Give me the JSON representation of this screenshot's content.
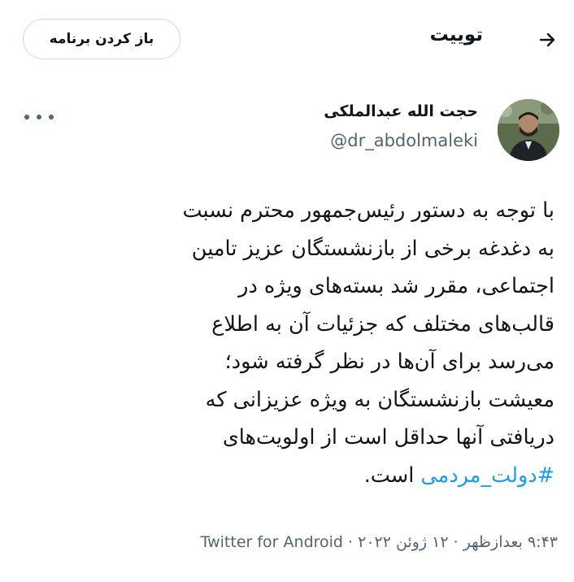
{
  "header": {
    "title": "توییت",
    "open_app_label": "باز کردن برنامه"
  },
  "icons": {
    "back": "back-arrow-icon",
    "more": "more-options-icon"
  },
  "author": {
    "name": "حجت الله عبدالملکی",
    "handle": "@dr_abdolmaleki"
  },
  "tweet": {
    "lines": [
      "با توجه به دستور رئیس‌جمهور محترم نسبت",
      "به دغدغه برخی از بازنشستگان عزیز تامین",
      "اجتماعی، مقرر شد بسته‌های ویژه در",
      "قالب‌های مختلف که جزئیات آن به اطلاع",
      "می‌رسد برای آن‌ها در نظر گرفته شود؛",
      "معیشت بازنشستگان به ویژه عزیزانی که",
      "دریافتی آنها حداقل است از اولویت‌های"
    ],
    "hashtag": "#دولت_مردمی",
    "last_line_tail": " است."
  },
  "meta": {
    "time": "۹:۴۳ بعدازظهر",
    "date": "۱۲ ژوئن ۲۰۲۲",
    "separator": " · ",
    "source": "Twitter for Android"
  },
  "colors": {
    "accent": "#1d9bf0",
    "text": "#0f1419",
    "secondary": "#536471",
    "border": "#cfd9de"
  }
}
